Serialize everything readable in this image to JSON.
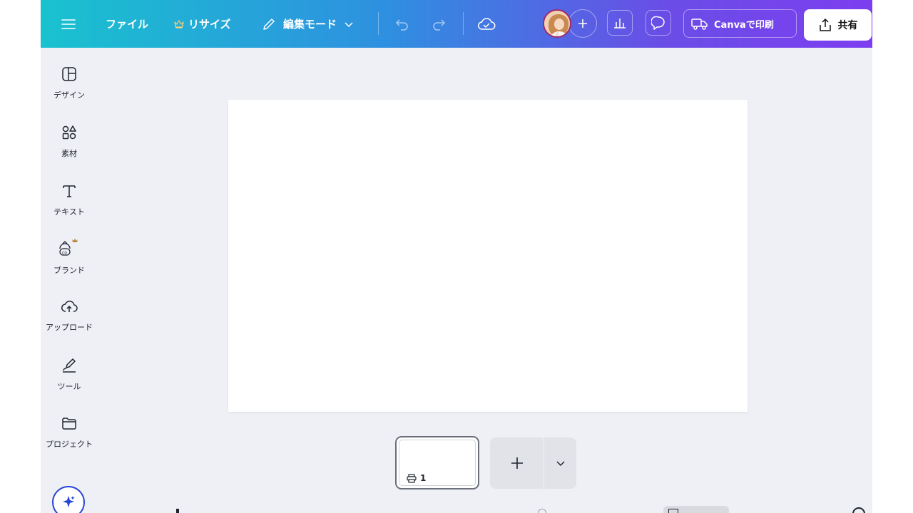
{
  "topbar": {
    "file_label": "ファイル",
    "resize_label": "リサイズ",
    "edit_mode_label": "編集モード",
    "print_label": "Canvaで印刷",
    "share_label": "共有"
  },
  "sidebar": {
    "items": [
      {
        "label": "デザイン",
        "icon": "layout-icon"
      },
      {
        "label": "素材",
        "icon": "elements-icon"
      },
      {
        "label": "テキスト",
        "icon": "text-icon"
      },
      {
        "label": "ブランド",
        "icon": "brand-icon"
      },
      {
        "label": "アップロード",
        "icon": "upload-cloud-icon"
      },
      {
        "label": "ツール",
        "icon": "draw-tool-icon"
      },
      {
        "label": "プロジェクト",
        "icon": "folder-icon"
      }
    ]
  },
  "pages": {
    "thumbnail_number": "1"
  },
  "colors": {
    "gradient_start": "#19c2cf",
    "gradient_end": "#7d3ef0",
    "workspace_bg": "#eff0f5",
    "canvas": "#ffffff",
    "magic_accent": "#2747d6"
  }
}
